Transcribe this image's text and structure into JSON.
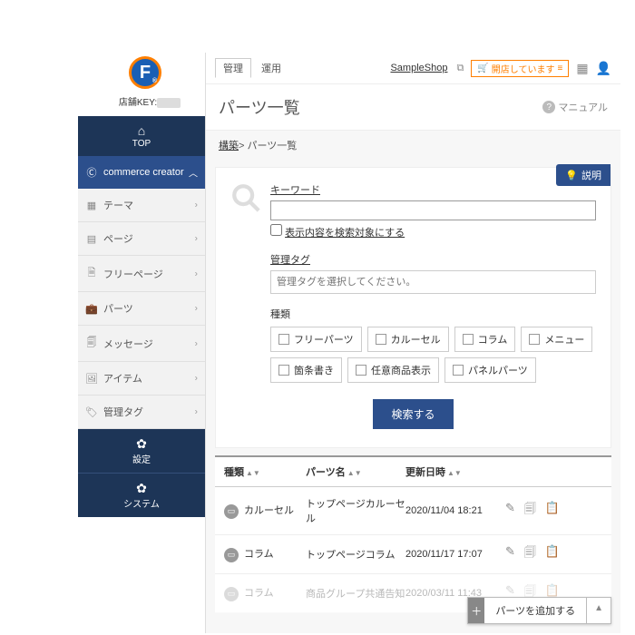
{
  "logo_letter": "F",
  "store_key_label": "店舗KEY:",
  "sidebar": {
    "top": "TOP",
    "active": "commerce creator",
    "items": [
      {
        "icon": "▦",
        "label": "テーマ"
      },
      {
        "icon": "▤",
        "label": "ページ"
      },
      {
        "icon": "🗎",
        "label": "フリーページ"
      },
      {
        "icon": "💼",
        "label": "パーツ"
      },
      {
        "icon": "🗐",
        "label": "メッセージ"
      },
      {
        "icon": "🖼",
        "label": "アイテム"
      },
      {
        "icon": "🏷",
        "label": "管理タグ"
      }
    ],
    "settings": "設定",
    "system": "システム"
  },
  "topbar": {
    "tab1": "管理",
    "tab2": "運用",
    "shop": "SampleShop",
    "open_badge": "開店しています"
  },
  "page_title": "パーツ一覧",
  "manual": "マニュアル",
  "breadcrumb": {
    "root": "構築",
    "leaf": "パーツ一覧"
  },
  "desc_badge": "説明",
  "search": {
    "keyword_label": "キーワード",
    "include_checkbox": "表示内容を検索対象にする",
    "tag_label": "管理タグ",
    "tag_placeholder": "管理タグを選択してください。",
    "type_label": "種類",
    "types": [
      "フリーパーツ",
      "カルーセル",
      "コラム",
      "メニュー",
      "箇条書き",
      "任意商品表示",
      "パネルパーツ"
    ],
    "button": "検索する"
  },
  "table": {
    "headers": {
      "kind": "種類",
      "name": "パーツ名",
      "updated": "更新日時"
    },
    "rows": [
      {
        "kind": "カルーセル",
        "name": "トップページカルーセル",
        "updated": "2020/11/04 18:21"
      },
      {
        "kind": "コラム",
        "name": "トップページコラム",
        "updated": "2020/11/17 17:07"
      },
      {
        "kind": "コラム",
        "name": "商品グループ共通告知",
        "updated": "2020/03/11 11:43",
        "dim": true
      }
    ]
  },
  "add_button": "パーツを追加する"
}
